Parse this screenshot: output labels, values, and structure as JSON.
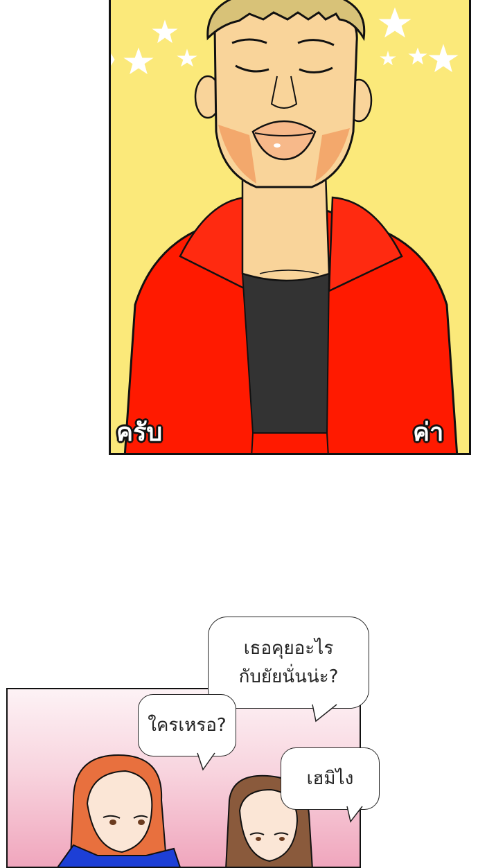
{
  "panel_top": {
    "sfx_left": "ครับ",
    "sfx_right": "ค่า"
  },
  "panel_bottom": {
    "bubble_1": {
      "line_1": "เธอคุยอะไร",
      "line_2": "กับยัยนั่นน่ะ?"
    },
    "bubble_2": "ใครเหรอ?",
    "bubble_3": "เฮมิไง"
  },
  "colors": {
    "panel_bg_yellow": "#fbe97a",
    "hoodie_red": "#ff1a00",
    "skin": "#f9d49a",
    "hair_blonde": "#d8c278",
    "shirt_dark": "#333333"
  }
}
